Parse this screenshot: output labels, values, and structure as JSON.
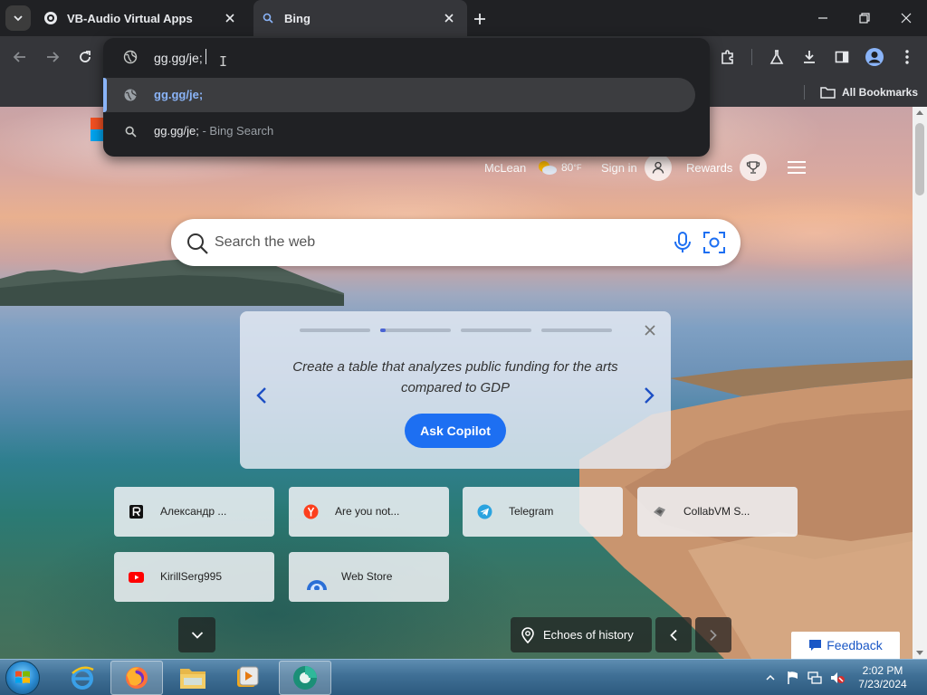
{
  "browser": {
    "tabs": [
      {
        "title": "VB-Audio Virtual Apps",
        "favicon": "globe-dark-icon",
        "active": false
      },
      {
        "title": "Bing",
        "favicon": "search-icon",
        "active": true
      }
    ],
    "omnibox": {
      "value": "gg.gg/je;",
      "suggestions": [
        {
          "text": "gg.gg/je;",
          "icon": "globe-icon",
          "selected": true
        },
        {
          "text": "gg.gg/je;",
          "suffix": " - Bing Search",
          "icon": "search-icon",
          "selected": false
        }
      ]
    },
    "bookmarks": {
      "all_bookmarks_label": "All Bookmarks"
    }
  },
  "bing": {
    "location": "McLean",
    "temperature": "80",
    "temp_unit": "°F",
    "sign_in": "Sign in",
    "rewards": "Rewards",
    "search_placeholder": "Search the web",
    "copilot_card": {
      "prompt": "Create a table that analyzes public funding for the arts compared to GDP",
      "button": "Ask Copilot",
      "dots": 4,
      "active_dot": 2
    },
    "quick_links": [
      {
        "label": "Александр ...",
        "icon": "r-logo-icon"
      },
      {
        "label": "Are you not...",
        "icon": "yandex-icon"
      },
      {
        "label": "Telegram",
        "icon": "telegram-icon"
      },
      {
        "label": "CollabVM S...",
        "icon": "collabvm-icon"
      },
      {
        "label": "KirillSerg995",
        "icon": "youtube-icon"
      },
      {
        "label": "Web Store",
        "icon": "web-store-icon"
      }
    ],
    "image_caption": "Echoes of history",
    "feedback": "Feedback"
  },
  "taskbar": {
    "time": "2:02 PM",
    "date": "7/23/2024"
  },
  "colors": {
    "accent_blue": "#1d6ff2",
    "chrome_dark": "#202124",
    "chrome_toolbar": "#35363a",
    "link_blue": "#8ab4f8"
  }
}
